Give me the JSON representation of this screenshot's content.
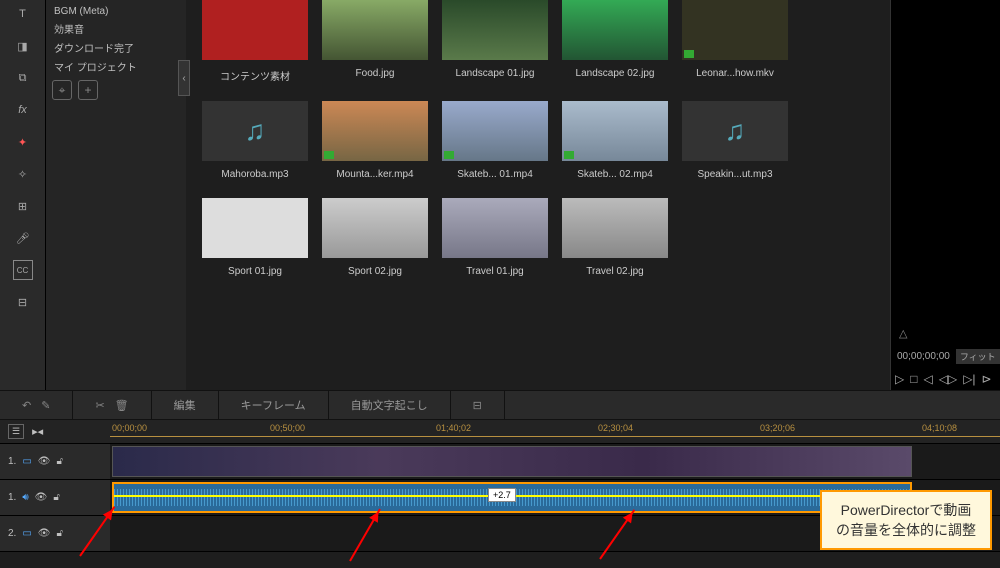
{
  "sidebar_tools": [
    "text",
    "clip",
    "media",
    "fx",
    "magic",
    "sparkle",
    "adjust",
    "mic",
    "cc",
    "grid9"
  ],
  "tree": {
    "items": [
      "BGM (Meta)",
      "効果音",
      "ダウンロード完了",
      "マイ プロジェクト"
    ]
  },
  "media": {
    "row1": [
      {
        "label": "コンテンツ素材",
        "type": "red"
      },
      {
        "label": "Food.jpg",
        "type": "img"
      },
      {
        "label": "Landscape 01.jpg",
        "type": "img"
      },
      {
        "label": "Landscape 02.jpg",
        "type": "img"
      },
      {
        "label": "Leonar...how.mkv",
        "type": "vid"
      }
    ],
    "row2": [
      {
        "label": "Mahoroba.mp3",
        "type": "music"
      },
      {
        "label": "Mounta...ker.mp4",
        "type": "vid"
      },
      {
        "label": "Skateb... 01.mp4",
        "type": "vid"
      },
      {
        "label": "Skateb... 02.mp4",
        "type": "vid"
      },
      {
        "label": "Speakin...ut.mp3",
        "type": "music"
      }
    ],
    "row3": [
      {
        "label": "Sport 01.jpg",
        "type": "img"
      },
      {
        "label": "Sport 02.jpg",
        "type": "img"
      },
      {
        "label": "Travel 01.jpg",
        "type": "img"
      },
      {
        "label": "Travel 02.jpg",
        "type": "img"
      }
    ]
  },
  "preview": {
    "time": "00;00;00;00",
    "fit": "フィット"
  },
  "toolbar": {
    "edit": "編集",
    "keyframe": "キーフレーム",
    "transcribe": "自動文字起こし"
  },
  "timeline": {
    "ticks": [
      "00;00;00",
      "00;50;00",
      "01;40;02",
      "02;30;04",
      "03;20;06",
      "04;10;08"
    ],
    "tracks": [
      {
        "n": "1.",
        "icon": "video"
      },
      {
        "n": "1.",
        "icon": "audio"
      },
      {
        "n": "2.",
        "icon": "video"
      }
    ],
    "volume": "+2.7"
  },
  "callout": {
    "l1": "PowerDirectorで動画",
    "l2": "の音量を全体的に調整"
  }
}
